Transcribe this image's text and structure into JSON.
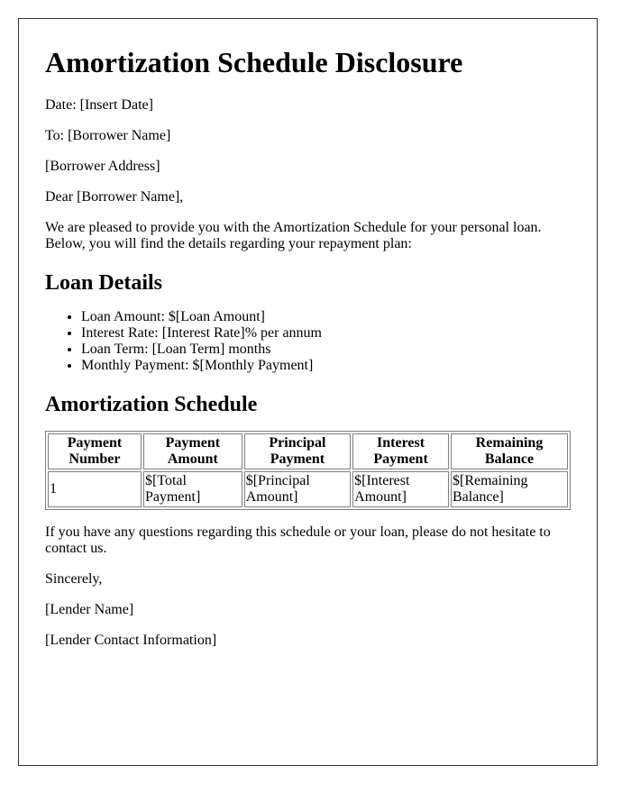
{
  "title": "Amortization Schedule Disclosure",
  "date_line": "Date: [Insert Date]",
  "to_line": "To: [Borrower Name]",
  "address_line": "[Borrower Address]",
  "salutation": "Dear [Borrower Name],",
  "intro": "We are pleased to provide you with the Amortization Schedule for your personal loan. Below, you will find the details regarding your repayment plan:",
  "loan_details": {
    "heading": "Loan Details",
    "items": [
      "Loan Amount: $[Loan Amount]",
      "Interest Rate: [Interest Rate]% per annum",
      "Loan Term: [Loan Term] months",
      "Monthly Payment: $[Monthly Payment]"
    ]
  },
  "schedule": {
    "heading": "Amortization Schedule",
    "headers": [
      "Payment Number",
      "Payment Amount",
      "Principal Payment",
      "Interest Payment",
      "Remaining Balance"
    ],
    "rows": [
      [
        "1",
        "$[Total Payment]",
        "$[Principal Amount]",
        "$[Interest Amount]",
        "$[Remaining Balance]"
      ]
    ]
  },
  "closing_text": "If you have any questions regarding this schedule or your loan, please do not hesitate to contact us.",
  "signoff": "Sincerely,",
  "lender_name": "[Lender Name]",
  "lender_contact": "[Lender Contact Information]"
}
